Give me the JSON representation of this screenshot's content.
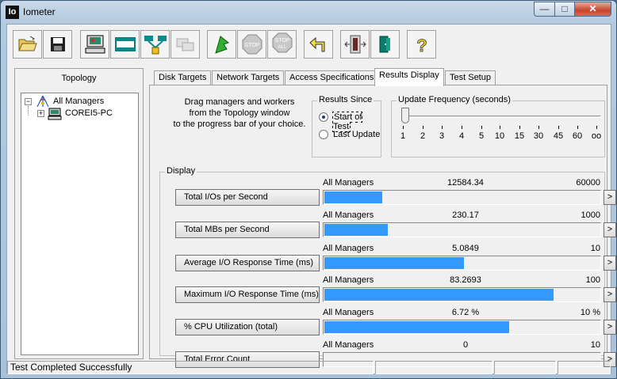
{
  "window": {
    "title": "Iometer",
    "icon_text": "Io",
    "minimize": "—",
    "maximize": "□",
    "close": "✕"
  },
  "toolbar": {
    "buttons": [
      {
        "name": "open-config-icon"
      },
      {
        "name": "save-config-icon"
      },
      {
        "name": "start-disk-worker-icon"
      },
      {
        "name": "start-network-worker-icon"
      },
      {
        "name": "duplicate-worker-icon"
      },
      {
        "name": "disconnect-icon"
      },
      {
        "name": "start-tests-icon"
      },
      {
        "name": "stop-test-icon",
        "text": "STOP"
      },
      {
        "name": "stop-all-icon",
        "text": "STOP",
        "text2": "ALL"
      },
      {
        "name": "reset-workers-icon"
      },
      {
        "name": "exit-icon"
      },
      {
        "name": "help-icon",
        "text": "?"
      }
    ]
  },
  "topology": {
    "header": "Topology",
    "root": "All Managers",
    "child": "COREI5-PC",
    "minus": "−",
    "plus": "+"
  },
  "tabs": [
    "Disk Targets",
    "Network Targets",
    "Access Specifications",
    "Results Display",
    "Test Setup"
  ],
  "instructions": [
    "Drag managers and workers",
    "from the Topology window",
    "to the progress bar of your choice."
  ],
  "results_since": {
    "legend": "Results Since",
    "start": "Start of Test",
    "last": "Last Update"
  },
  "update_frequency": {
    "legend": "Update Frequency (seconds)",
    "ticks": [
      "1",
      "2",
      "3",
      "4",
      "5",
      "10",
      "15",
      "30",
      "45",
      "60",
      "oo"
    ]
  },
  "display": {
    "legend": "Display",
    "arrow": ">",
    "rows": [
      {
        "label": "Total I/Os per Second",
        "source": "All Managers",
        "value": "12584.34",
        "max": "60000",
        "fill": 0.2097
      },
      {
        "label": "Total MBs per Second",
        "source": "All Managers",
        "value": "230.17",
        "max": "1000",
        "fill": 0.2302
      },
      {
        "label": "Average I/O Response Time (ms)",
        "source": "All Managers",
        "value": "5.0849",
        "max": "10",
        "fill": 0.5085
      },
      {
        "label": "Maximum I/O Response Time (ms)",
        "source": "All Managers",
        "value": "83.2693",
        "max": "100",
        "fill": 0.8327
      },
      {
        "label": "% CPU Utilization (total)",
        "source": "All Managers",
        "value": "6.72 %",
        "max": "10 %",
        "fill": 0.672
      },
      {
        "label": "Total Error Count",
        "source": "All Managers",
        "value": "0",
        "max": "10",
        "fill": 0
      }
    ]
  },
  "status": {
    "text": "Test Completed Successfully"
  },
  "colors": {
    "bar": "#3399ff",
    "window_frame": "#b3c9de"
  }
}
